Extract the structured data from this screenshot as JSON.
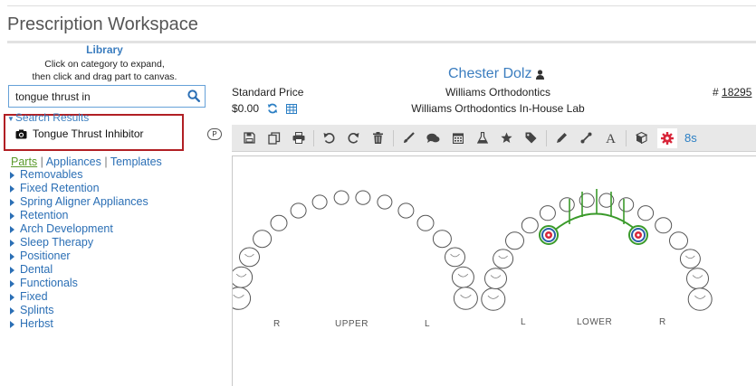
{
  "page_title": "Prescription Workspace",
  "library": {
    "title": "Library",
    "help_line1": "Click on category to expand,",
    "help_line2": "then click and drag part to canvas.",
    "search_value": "tongue thrust in",
    "search_results_label": "Search Results",
    "result_item": "Tongue Thrust Inhibitor",
    "badge": "P"
  },
  "category_tabs": [
    "Parts",
    "Appliances",
    "Templates"
  ],
  "categories": [
    "Removables",
    "Fixed Retention",
    "Spring Aligner Appliances",
    "Retention",
    "Arch Development",
    "Sleep Therapy",
    "Positioner",
    "Dental",
    "Functionals",
    "Fixed",
    "Splints",
    "Herbst"
  ],
  "patient": {
    "name": "Chester Dolz",
    "price_label": "Standard Price",
    "price_value": "$0.00",
    "practice": "Williams Orthodontics",
    "lab": "Williams Orthodontics In-House Lab",
    "rx_prefix": "#",
    "rx_number": "18295"
  },
  "toolbar": {
    "time_label": "8s"
  },
  "canvas": {
    "upper": {
      "label": "UPPER",
      "right": "R",
      "left": "L"
    },
    "lower": {
      "label": "LOWER",
      "left": "L",
      "right": "R"
    }
  },
  "colors": {
    "accent": "#3b7dbf",
    "highlight_border": "#b11f24",
    "wire": "#3a9a2a",
    "gear": "#d8263a"
  }
}
